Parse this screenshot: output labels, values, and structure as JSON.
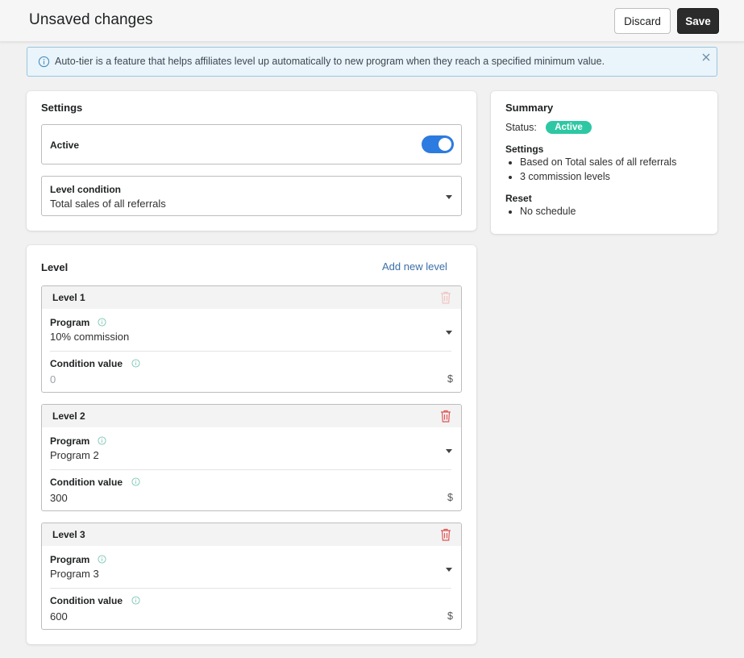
{
  "header": {
    "title": "Unsaved changes",
    "discard_label": "Discard",
    "save_label": "Save"
  },
  "banner": {
    "text": "Auto-tier is a feature that helps affiliates level up automatically to new program when they reach a specified minimum value."
  },
  "settings": {
    "heading": "Settings",
    "active_label": "Active",
    "active_on": true,
    "level_condition_label": "Level condition",
    "level_condition_value": "Total sales of all referrals"
  },
  "summary": {
    "heading": "Summary",
    "status_label": "Status:",
    "status_value": "Active",
    "settings_heading": "Settings",
    "settings_items": [
      "Based on Total sales of all referrals",
      "3 commission levels"
    ],
    "reset_heading": "Reset",
    "reset_items": [
      "No schedule"
    ]
  },
  "levels": {
    "heading": "Level",
    "add_label": "Add new level",
    "program_label": "Program",
    "condition_label": "Condition value",
    "currency": "$",
    "items": [
      {
        "name": "Level 1",
        "program": "10% commission",
        "condition_value": "0",
        "deletable": false
      },
      {
        "name": "Level 2",
        "program": "Program 2",
        "condition_value": "300",
        "deletable": true
      },
      {
        "name": "Level 3",
        "program": "Program 3",
        "condition_value": "600",
        "deletable": true
      }
    ]
  },
  "colors": {
    "accent": "#2c7be0",
    "badge": "#2dc8a3",
    "link": "#3b6fa7",
    "trash": "#e05656",
    "trash_disabled": "#f2c4c4",
    "banner_bg": "#eaf4fb",
    "banner_border": "#98c6de"
  },
  "icons": {
    "banner": "info-icon",
    "banner_close": "close-icon",
    "field_info": "info-icon",
    "delete": "trash-icon",
    "dropdown": "chevron-down-icon"
  }
}
